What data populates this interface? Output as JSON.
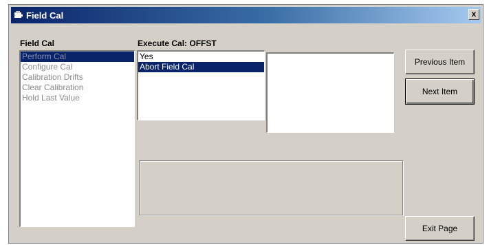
{
  "window": {
    "title": "Field Cal",
    "close_label": "x"
  },
  "left_panel": {
    "label": "Field Cal",
    "items": [
      {
        "label": "Perform Cal"
      },
      {
        "label": "Configure Cal"
      },
      {
        "label": "Calibration Drifts"
      },
      {
        "label": "Clear Calibration"
      },
      {
        "label": "Hold Last Value"
      }
    ]
  },
  "execute_panel": {
    "label": "Execute Cal:  OFFST",
    "items": [
      {
        "label": "Yes"
      },
      {
        "label": "Abort Field Cal"
      }
    ]
  },
  "buttons": {
    "previous_label": "Previous Item",
    "next_label": "Next Item",
    "exit_label": "Exit Page"
  },
  "colors": {
    "title_gradient_start": "#0a246a",
    "selection": "#0a246a",
    "window_face": "#d4d0c8"
  }
}
